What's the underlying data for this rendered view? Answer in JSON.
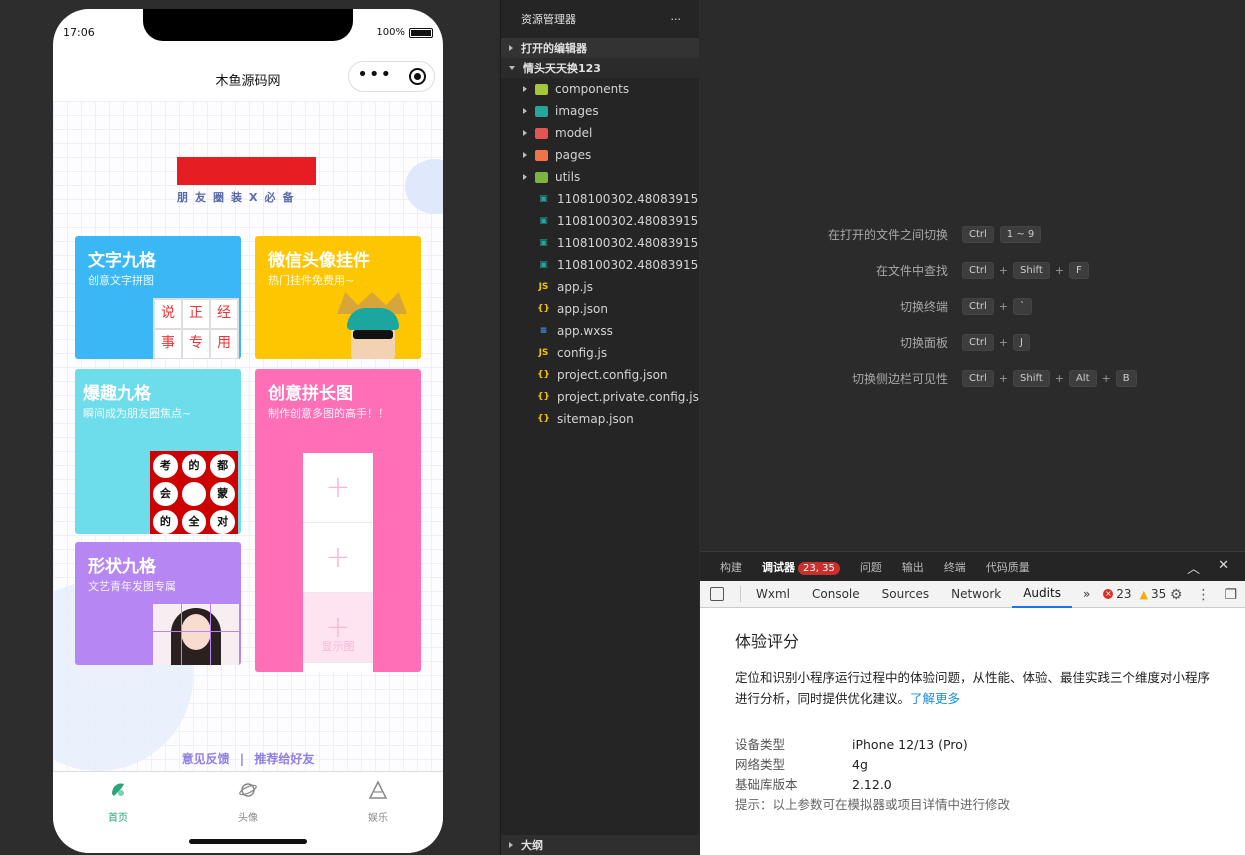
{
  "simulator": {
    "status_time": "17:06",
    "battery": "100%",
    "nav_title": "木鱼源码网",
    "logo_caption": "朋友圈装X必备",
    "cards": [
      {
        "title": "文字九格",
        "subtitle": "创意文字拼图",
        "grid": [
          "说",
          "正",
          "经",
          "事",
          "专",
          "用"
        ]
      },
      {
        "title": "微信头像挂件",
        "subtitle": "热门挂件免费用~"
      },
      {
        "title": "爆趣九格",
        "subtitle": "瞬间成为朋友圈焦点~",
        "grid": [
          "考",
          "的",
          "都",
          "会",
          "",
          "蒙",
          "的",
          "全",
          "对"
        ]
      },
      {
        "title": "创意拼长图",
        "subtitle": "制作创意多图的高手！！",
        "strip_label": "显示图"
      },
      {
        "title": "形状九格",
        "subtitle": "文艺青年发图专属"
      }
    ],
    "footer_links": [
      "意见反馈",
      "推荐给好友"
    ],
    "footer_sep": "|",
    "tabs": [
      {
        "label": "首页",
        "icon": "home-icon",
        "active": true
      },
      {
        "label": "头像",
        "icon": "planet-icon",
        "active": false
      },
      {
        "label": "娱乐",
        "icon": "triangle-icon",
        "active": false
      }
    ],
    "accent": "#2ba37c"
  },
  "explorer": {
    "title": "资源管理器",
    "more": "···",
    "sections": [
      "打开的编辑器",
      "情头天天换123"
    ],
    "folders": [
      {
        "name": "components",
        "color": "#a4c639"
      },
      {
        "name": "images",
        "color": "#26a69a"
      },
      {
        "name": "model",
        "color": "#e55353"
      },
      {
        "name": "pages",
        "color": "#f0734a"
      },
      {
        "name": "utils",
        "color": "#7cb342"
      }
    ],
    "files": [
      {
        "name": "1108100302.48083915...",
        "icon": "image-file-icon",
        "glyph": "▣",
        "color": "#26a69a"
      },
      {
        "name": "1108100302.48083915...",
        "icon": "image-file-icon",
        "glyph": "▣",
        "color": "#26a69a"
      },
      {
        "name": "1108100302.48083915...",
        "icon": "image-file-icon",
        "glyph": "▣",
        "color": "#26a69a"
      },
      {
        "name": "1108100302.48083915...",
        "icon": "image-file-icon",
        "glyph": "▣",
        "color": "#26a69a"
      },
      {
        "name": "app.js",
        "icon": "js-file-icon",
        "glyph": "JS",
        "color": "#f1c40f"
      },
      {
        "name": "app.json",
        "icon": "json-file-icon",
        "glyph": "{}",
        "color": "#f1c40f"
      },
      {
        "name": "app.wxss",
        "icon": "css-file-icon",
        "glyph": "≡",
        "color": "#42a5f5"
      },
      {
        "name": "config.js",
        "icon": "js-file-icon",
        "glyph": "JS",
        "color": "#f1c40f"
      },
      {
        "name": "project.config.json",
        "icon": "json-file-icon",
        "glyph": "{}",
        "color": "#f1c40f"
      },
      {
        "name": "project.private.config.js...",
        "icon": "json-file-icon",
        "glyph": "{}",
        "color": "#f1c40f"
      },
      {
        "name": "sitemap.json",
        "icon": "json-file-icon",
        "glyph": "{}",
        "color": "#f1c40f"
      }
    ],
    "outline": "大纲"
  },
  "shortcuts": [
    {
      "label": "在打开的文件之间切换",
      "keys": [
        "Ctrl",
        "1 ~ 9"
      ],
      "joined": false
    },
    {
      "label": "在文件中查找",
      "keys": [
        "Ctrl",
        "Shift",
        "F"
      ],
      "joined": true
    },
    {
      "label": "切换终端",
      "keys": [
        "Ctrl",
        "`"
      ],
      "joined": true
    },
    {
      "label": "切换面板",
      "keys": [
        "Ctrl",
        "J"
      ],
      "joined": true
    },
    {
      "label": "切换侧边栏可见性",
      "keys": [
        "Ctrl",
        "Shift",
        "Alt",
        "B"
      ],
      "joined": true
    }
  ],
  "panel": {
    "tabs": [
      "构建",
      "调试器",
      "问题",
      "输出",
      "终端",
      "代码质量"
    ],
    "badge": "23, 35",
    "devtools_tabs": [
      "Wxml",
      "Console",
      "Sources",
      "Network",
      "Audits"
    ],
    "active_devtools": "Audits",
    "more_tabs": "»",
    "errors": "23",
    "warnings": "35",
    "audit": {
      "title": "体验评分",
      "desc": "定位和识别小程序运行过程中的体验问题，从性能、体验、最佳实践三个维度对小程序进行分析，同时提供优化建议。",
      "link": "了解更多",
      "info": [
        {
          "k": "设备类型",
          "v": "iPhone 12/13 (Pro)"
        },
        {
          "k": "网络类型",
          "v": "4g"
        },
        {
          "k": "基础库版本",
          "v": "2.12.0"
        }
      ],
      "hint": "提示：以上参数可在模拟器或项目详情中进行修改"
    }
  }
}
